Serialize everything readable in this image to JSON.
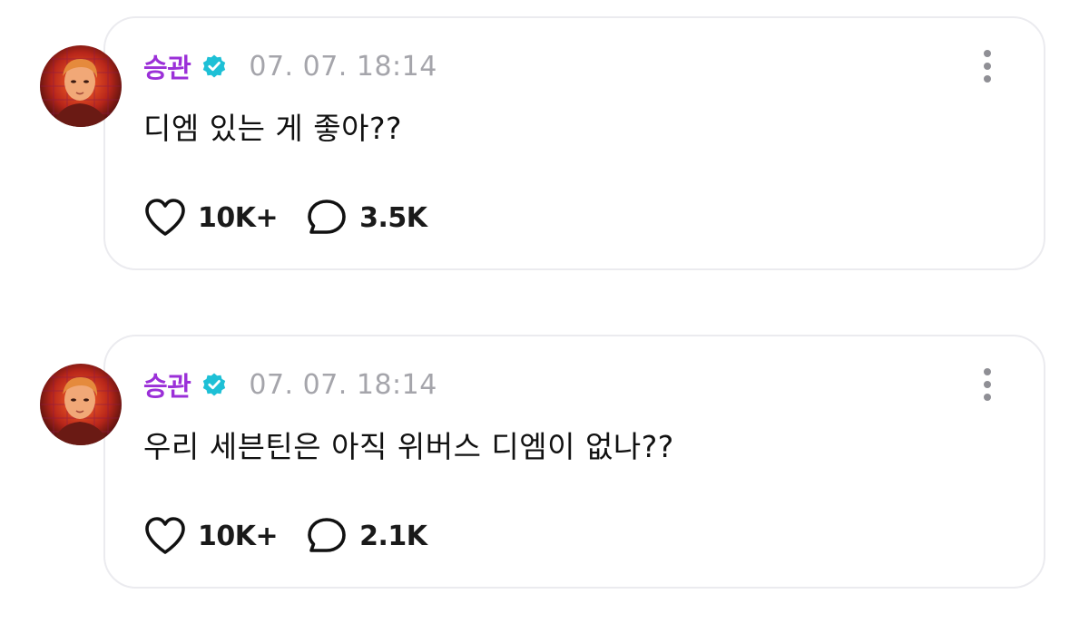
{
  "posts": [
    {
      "author": "승관",
      "timestamp": "07. 07. 18:14",
      "text": "디엠 있는 게 좋아??",
      "likes": "10K+",
      "comments": "3.5K"
    },
    {
      "author": "승관",
      "timestamp": "07. 07. 18:14",
      "text": "우리 세븐틴은 아직 위버스 디엠이 없나??",
      "likes": "10K+",
      "comments": "2.1K"
    }
  ],
  "icons": {
    "verified": "verified-badge-icon",
    "more": "more-vertical-icon",
    "like": "heart-icon",
    "comment": "comment-bubble-icon"
  },
  "colors": {
    "author": "#9b30d8",
    "verified": "#1ec0d6",
    "timestamp": "#a5a5ab",
    "card_border": "#ebebef"
  }
}
